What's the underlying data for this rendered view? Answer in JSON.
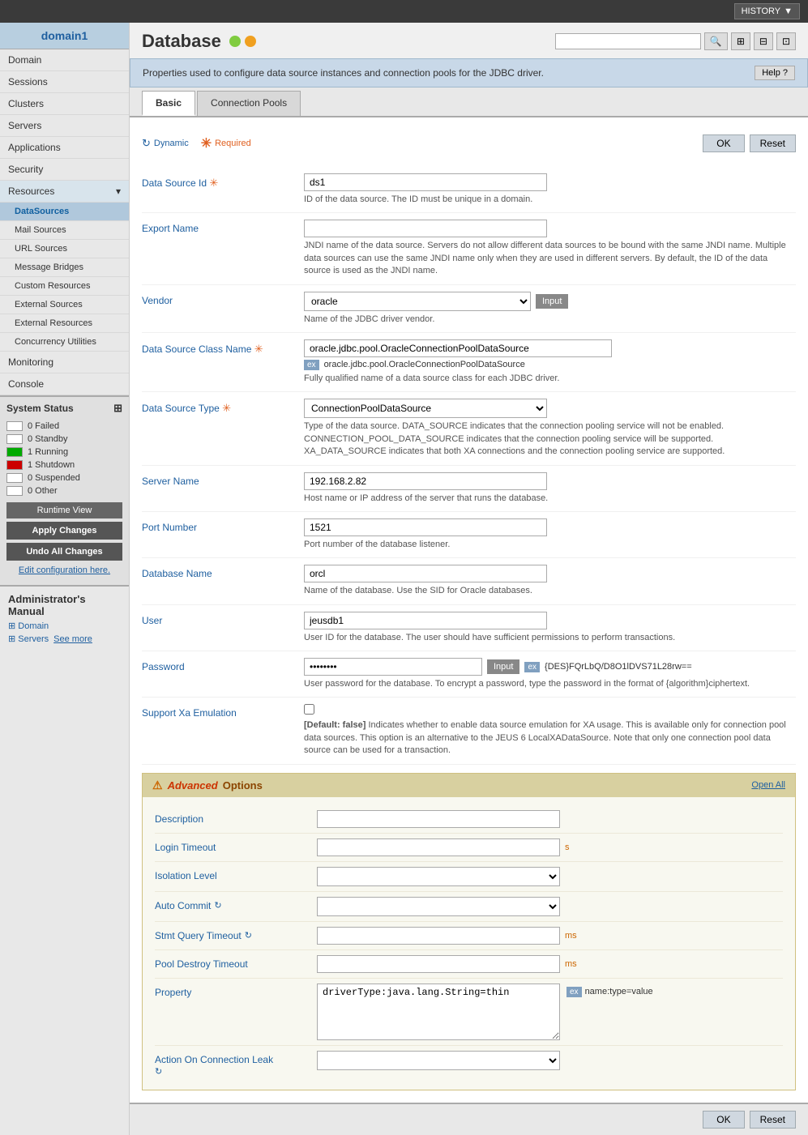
{
  "topbar": {
    "history_label": "HISTORY",
    "history_arrow": "▼"
  },
  "sidebar": {
    "domain_name": "domain1",
    "nav_items": [
      {
        "label": "Domain"
      },
      {
        "label": "Sessions"
      },
      {
        "label": "Clusters"
      },
      {
        "label": "Servers"
      },
      {
        "label": "Applications"
      },
      {
        "label": "Security"
      },
      {
        "label": "Resources",
        "has_arrow": true
      }
    ],
    "sub_items": [
      {
        "label": "DataSources",
        "active": true
      },
      {
        "label": "Mail Sources"
      },
      {
        "label": "URL Sources"
      },
      {
        "label": "Message Bridges"
      },
      {
        "label": "Custom Resources"
      },
      {
        "label": "External Sources"
      },
      {
        "label": "External Resources"
      },
      {
        "label": "Concurrency Utilities"
      }
    ],
    "other_nav": [
      {
        "label": "Monitoring"
      },
      {
        "label": "Console"
      }
    ],
    "system_status": {
      "title": "System Status",
      "rows": [
        {
          "count": "0",
          "label": "Failed",
          "type": "empty"
        },
        {
          "count": "0",
          "label": "Standby",
          "type": "empty"
        },
        {
          "count": "1",
          "label": "Running",
          "type": "running"
        },
        {
          "count": "1",
          "label": "Shutdown",
          "type": "shutdown"
        },
        {
          "count": "0",
          "label": "Suspended",
          "type": "empty"
        },
        {
          "count": "0",
          "label": "Other",
          "type": "empty"
        }
      ],
      "runtime_btn": "Runtime View",
      "apply_btn": "Apply Changes",
      "undo_btn": "Undo All Changes",
      "edit_config": "Edit configuration here."
    },
    "admin_manual": {
      "title": "Administrator's Manual",
      "domain_link": "Domain",
      "servers_link": "Servers",
      "see_more": "See more"
    }
  },
  "content": {
    "page_title": "Database",
    "search_placeholder": "",
    "info_bar": "Properties used to configure data source instances and connection pools for the JDBC driver.",
    "help_btn": "Help ?",
    "tabs": [
      {
        "label": "Basic",
        "active": true
      },
      {
        "label": "Connection Pools",
        "active": false
      }
    ],
    "indicators": {
      "dynamic_label": "Dynamic",
      "required_label": "Required"
    },
    "ok_btn": "OK",
    "reset_btn": "Reset",
    "form_fields": [
      {
        "label": "Data Source Id",
        "required": true,
        "value": "ds1",
        "desc": "ID of the data source. The ID must be unique in a domain."
      },
      {
        "label": "Export Name",
        "required": false,
        "value": "",
        "desc": "JNDI name of the data source. Servers do not allow different data sources to be bound with the same JNDI name. Multiple data sources can use the same JNDI name only when they are used in different servers. By default, the ID of the data source is used as the JNDI name."
      },
      {
        "label": "Vendor",
        "required": false,
        "type": "select_input",
        "value": "oracle",
        "btn_label": "Input"
      },
      {
        "label": "Data Source Class Name",
        "required": true,
        "type": "text_with_ex",
        "value": "oracle.jdbc.pool.OracleConnectionPoolDataSource",
        "ex_value": "oracle.jdbc.pool.OracleConnectionPoolDataSource",
        "desc": "Fully qualified name of a data source class for each JDBC driver."
      },
      {
        "label": "Data Source Type",
        "required": true,
        "type": "select",
        "value": "ConnectionPoolDataSource",
        "desc": "Type of the data source. DATA_SOURCE indicates that the connection pooling service will not be enabled. CONNECTION_POOL_DATA_SOURCE indicates that the connection pooling service will be supported. XA_DATA_SOURCE indicates that both XA connections and the connection pooling service are supported."
      },
      {
        "label": "Server Name",
        "required": false,
        "value": "192.168.2.82",
        "desc": "Host name or IP address of the server that runs the database."
      },
      {
        "label": "Port Number",
        "required": false,
        "value": "1521",
        "desc": "Port number of the database listener."
      },
      {
        "label": "Database Name",
        "required": false,
        "value": "orcl",
        "desc": "Name of the database. Use the SID for Oracle databases."
      },
      {
        "label": "User",
        "required": false,
        "value": "jeusdb1",
        "desc": "User ID for the database. The user should have sufficient permissions to perform transactions."
      },
      {
        "label": "Password",
        "required": false,
        "type": "password_with_ex",
        "value": "• • • • • •",
        "btn_label": "Input",
        "ex_value": "{DES}FQrLbQ/D8O1lDVS71L28rw==",
        "desc": "User password for the database. To encrypt a password, type the password in the format of {algorithm}ciphertext."
      },
      {
        "label": "Support Xa Emulation",
        "required": false,
        "type": "checkbox",
        "desc": "[Default: false]  Indicates whether to enable data source emulation for XA usage. This is available only for connection pool data sources. This option is an alternative to the JEUS 6 LocalXADataSource. Note that only one connection pool data source can be used for a transaction."
      }
    ],
    "advanced": {
      "title_warn": "⚠",
      "title_adv": "Advanced",
      "title_rest": "Options",
      "open_all": "Open All",
      "fields": [
        {
          "label": "Description",
          "type": "text",
          "value": "",
          "hint": ""
        },
        {
          "label": "Login Timeout",
          "type": "text",
          "value": "",
          "hint": "s"
        },
        {
          "label": "Isolation Level",
          "type": "select",
          "value": ""
        },
        {
          "label": "Auto Commit",
          "type": "select_icon",
          "value": "",
          "icon": true
        },
        {
          "label": "Stmt Query Timeout",
          "type": "text_icon",
          "value": "",
          "hint": "ms",
          "icon": true
        },
        {
          "label": "Pool Destroy Timeout",
          "type": "text",
          "value": "",
          "hint": "ms"
        },
        {
          "label": "Property",
          "type": "textarea_ex",
          "value": "driverType:java.lang.String=thin",
          "ex_value": "name:type=value"
        },
        {
          "label": "Action On Connection Leak",
          "type": "select_icon",
          "value": "",
          "icon": true
        }
      ]
    },
    "bottom_ok": "OK",
    "bottom_reset": "Reset"
  }
}
